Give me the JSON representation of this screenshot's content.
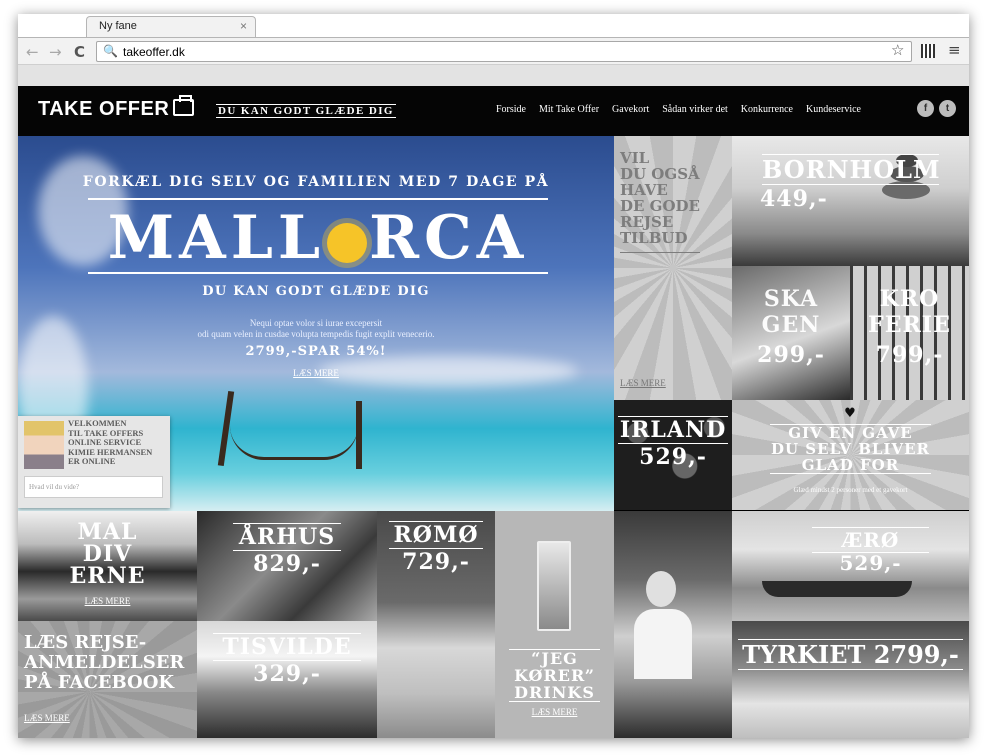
{
  "browser": {
    "tab_title": "Ny fane",
    "tab_close": "×",
    "url": "takeoffer.dk",
    "back": "←",
    "forward": "→",
    "reload": "C",
    "star": "☆",
    "menu": "≡"
  },
  "site": {
    "logo": "TAKE OFFER",
    "slogan": "DU KAN GODT GLÆDE DIG",
    "nav": [
      "Forside",
      "Mit Take Offer",
      "Gavekort",
      "Sådan virker det",
      "Konkurrence",
      "Kundeservice"
    ],
    "social": [
      "f",
      "t"
    ]
  },
  "hero": {
    "pre": "FORKÆL DIG SELV OG FAMILIEN MED 7 DAGE PÅ",
    "title_left": "MALL",
    "title_right": "RCA",
    "sub": "DU KAN GODT GLÆDE DIG",
    "body_line1": "Nequi optae volor si iurae excepersit",
    "body_line2": "odi quam velen in cusdae volupta tempedis fugit explit venecerio.",
    "price": "2799,-SPAR 54%!",
    "more": "LÆS MERE"
  },
  "chat": {
    "msg_line1": "VELKOMMEN",
    "msg_line2": "TIL TAKE OFFERS",
    "msg_line3": "ONLINE SERVICE",
    "msg_line4": "KIMIE HERMANSEN",
    "msg_line5": "ER ONLINE",
    "placeholder": "Hvad vil du vide?"
  },
  "tiles": {
    "vil": {
      "line1": "VIL",
      "line2": "DU OGSÅ",
      "line3": "HAVE",
      "line4": "DE GODE",
      "line5": "REJSE",
      "line6": "TILBUD",
      "more": "LÆS MERE"
    },
    "bornholm": {
      "name": "BORNHOLM",
      "price": "449,-"
    },
    "skagen": {
      "name1": "SKA",
      "name2": "GEN",
      "price": "299,-"
    },
    "kroferie": {
      "name1": "KRO",
      "name2": "FERIE",
      "price": "799,-"
    },
    "irland": {
      "name": "IRLAND",
      "price": "529,-"
    },
    "gift": {
      "heart": "♥",
      "line1": "GIV EN GAVE",
      "line2": "DU SELV BLIVER",
      "line3": "GLAD FOR",
      "small": "Glæd mindst 2 personer med et gavekort"
    },
    "maldiverne": {
      "line1": "MAL",
      "line2": "DIV",
      "line3": "ERNE",
      "more": "LÆS MERE"
    },
    "aarhus": {
      "name": "ÅRHUS",
      "price": "829,-"
    },
    "romo": {
      "name": "RØMØ",
      "price": "729,-"
    },
    "drinks": {
      "line1": "“JEG",
      "line2": "KØRER”",
      "line3": "DRINKS",
      "more": "LÆS MERE"
    },
    "aero": {
      "name": "ÆRØ",
      "price": "529,-"
    },
    "facebook": {
      "line1": "LÆS REJSE-",
      "line2": "ANMELDELSER",
      "line3": "PÅ FACEBOOK",
      "more": "LÆS MERE"
    },
    "tisvilde": {
      "name": "TISVILDE",
      "price": "329,-"
    },
    "tyrkiet": {
      "text": "TYRKIET 2799,-"
    }
  }
}
